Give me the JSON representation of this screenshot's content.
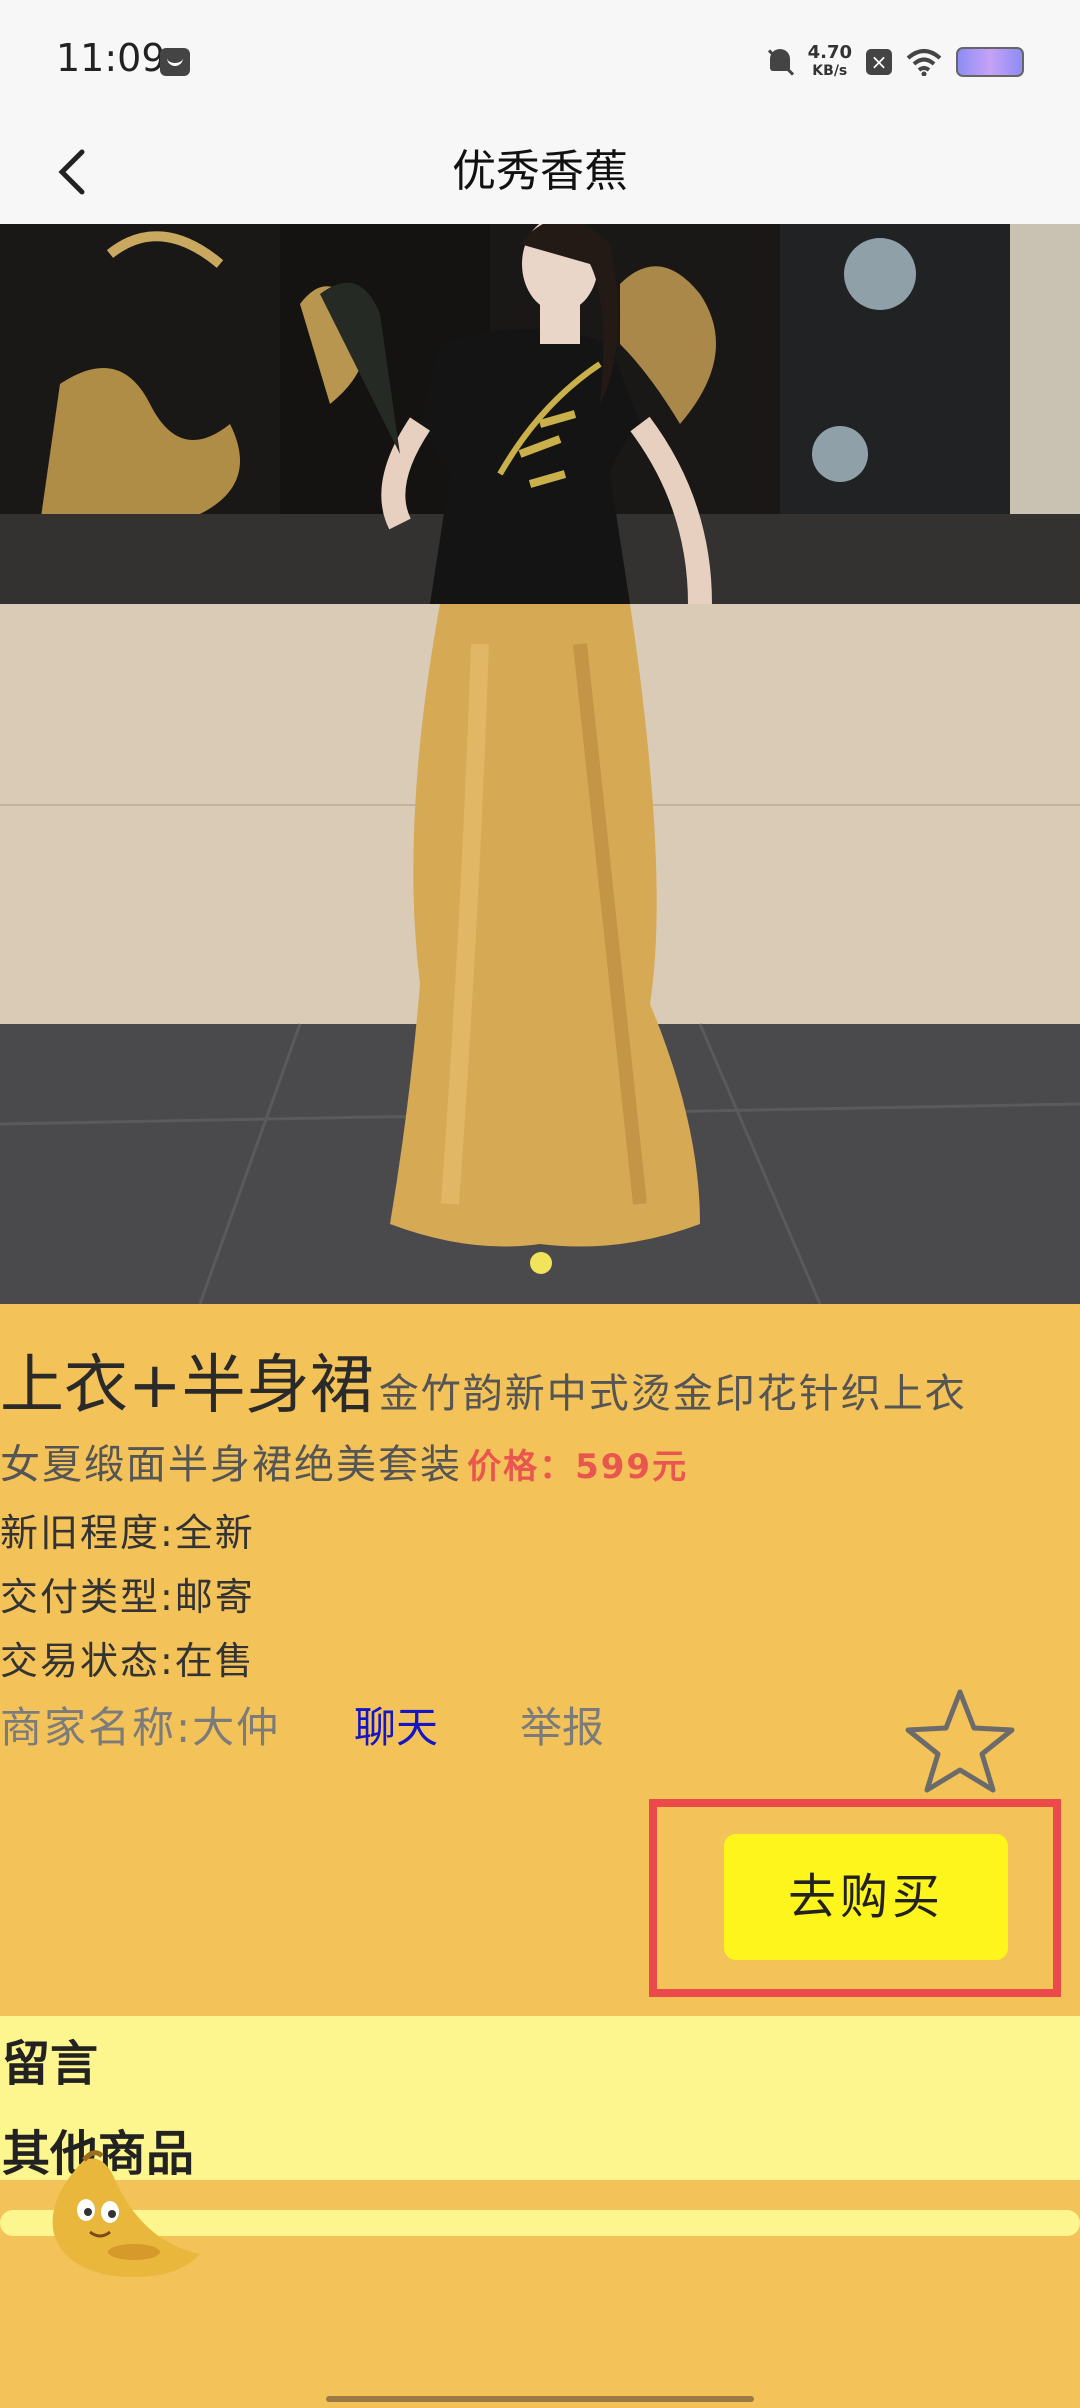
{
  "status_bar": {
    "time": "11:09",
    "net_speed_value": "4.70",
    "net_speed_unit": "KB/s"
  },
  "header": {
    "title": "优秀香蕉"
  },
  "product": {
    "name": "上衣+半身裙",
    "description_line1": "金竹韵新中式烫金印花针织上衣",
    "description_line2": "女夏缎面半身裙绝美套装",
    "price": "价格：599元",
    "condition": "新旧程度:全新",
    "delivery": "交付类型:邮寄",
    "trade_status": "交易状态:在售",
    "seller": "商家名称:大仲",
    "chat_label": "聊天",
    "report_label": "举报",
    "buy_label": "去购买"
  },
  "sections": {
    "comments": "留言",
    "other_items": "其他商品"
  },
  "colors": {
    "page_bg": "#f3c258",
    "band": "#fdf58e",
    "buy_button": "#fdf51b",
    "price": "#e9564f",
    "highlight": "#ec4a4a",
    "chat_link": "#1515c8"
  },
  "icons": {
    "back": "chevron-left-icon",
    "favorite": "star-outline-icon",
    "mascot": "banana-mascot-icon"
  }
}
